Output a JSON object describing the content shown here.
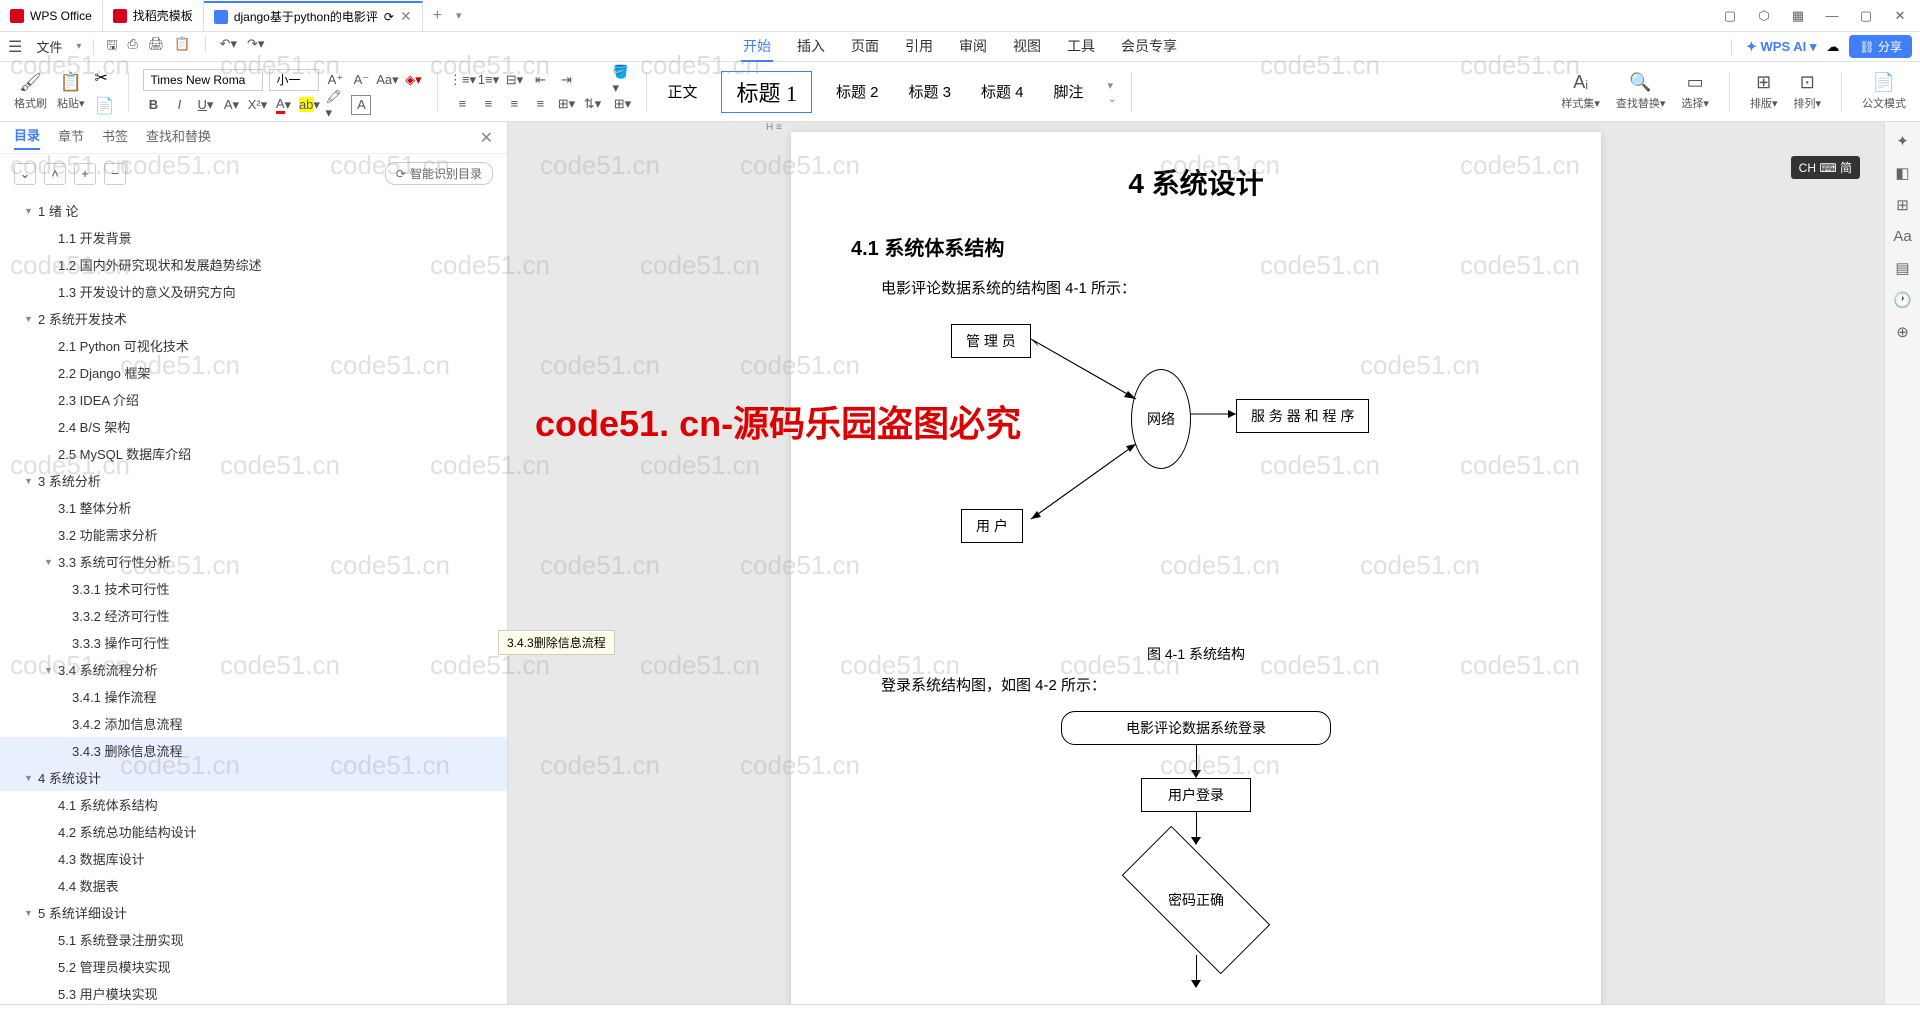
{
  "titlebar": {
    "tabs": [
      {
        "label": "WPS Office",
        "icon": "wps"
      },
      {
        "label": "找稻壳模板",
        "icon": "docer"
      },
      {
        "label": "django基于python的电影评",
        "icon": "doc",
        "active": true
      }
    ],
    "win_icons": [
      "▢",
      "⬡",
      "▦",
      "—",
      "▢",
      "✕"
    ]
  },
  "menubar": {
    "file": "文件",
    "tabs": [
      "开始",
      "插入",
      "页面",
      "引用",
      "审阅",
      "视图",
      "工具",
      "会员专享"
    ],
    "active_tab": "开始",
    "wps_ai": "WPS AI",
    "share": "分享"
  },
  "ribbon": {
    "format_painter": "格式刷",
    "paste": "粘贴",
    "font": "Times New Roma",
    "size": "小一",
    "styles": {
      "normal": "正文",
      "h1": "标题 1",
      "h2": "标题 2",
      "h3": "标题 3",
      "h4": "标题 4"
    },
    "footnote": "脚注",
    "styleset": "样式集",
    "findreplace": "查找替换",
    "select": "选择",
    "sort": "排版",
    "arrange": "排列",
    "official": "公文模式"
  },
  "sidebar": {
    "tabs": [
      "目录",
      "章节",
      "书签",
      "查找和替换"
    ],
    "active": "目录",
    "auto_toc": "智能识别目录",
    "toc": [
      {
        "level": 1,
        "num": "1",
        "title": "绪 论",
        "arrow": true
      },
      {
        "level": 2,
        "num": "1.1",
        "title": "开发背景"
      },
      {
        "level": 2,
        "num": "1.2",
        "title": "国内外研究现状和发展趋势综述"
      },
      {
        "level": 2,
        "num": "1.3",
        "title": "开发设计的意义及研究方向"
      },
      {
        "level": 1,
        "num": "2",
        "title": "系统开发技术",
        "arrow": true
      },
      {
        "level": 2,
        "num": "2.1",
        "title": "Python 可视化技术"
      },
      {
        "level": 2,
        "num": "2.2",
        "title": "Django 框架"
      },
      {
        "level": 2,
        "num": "2.3",
        "title": "IDEA 介绍"
      },
      {
        "level": 2,
        "num": "2.4",
        "title": "B/S 架构"
      },
      {
        "level": 2,
        "num": "2.5",
        "title": "MySQL 数据库介绍"
      },
      {
        "level": 1,
        "num": "3",
        "title": "系统分析",
        "arrow": true
      },
      {
        "level": 2,
        "num": "3.1",
        "title": "整体分析"
      },
      {
        "level": 2,
        "num": "3.2",
        "title": "功能需求分析"
      },
      {
        "level": 2,
        "num": "3.3",
        "title": "系统可行性分析",
        "arrow": true
      },
      {
        "level": 3,
        "num": "3.3.1",
        "title": "技术可行性"
      },
      {
        "level": 3,
        "num": "3.3.2",
        "title": "经济可行性"
      },
      {
        "level": 3,
        "num": "3.3.3",
        "title": "操作可行性"
      },
      {
        "level": 2,
        "num": "3.4",
        "title": "系统流程分析",
        "arrow": true
      },
      {
        "level": 3,
        "num": "3.4.1",
        "title": "操作流程"
      },
      {
        "level": 3,
        "num": "3.4.2",
        "title": "添加信息流程"
      },
      {
        "level": 3,
        "num": "3.4.3",
        "title": "删除信息流程",
        "selected": true
      },
      {
        "level": 1,
        "num": "4",
        "title": "系统设计",
        "arrow": true,
        "selected": true
      },
      {
        "level": 2,
        "num": "4.1",
        "title": "系统体系结构"
      },
      {
        "level": 2,
        "num": "4.2",
        "title": "系统总功能结构设计"
      },
      {
        "level": 2,
        "num": "4.3",
        "title": "数据库设计"
      },
      {
        "level": 2,
        "num": "4.4",
        "title": "数据表"
      },
      {
        "level": 1,
        "num": "5",
        "title": "系统详细设计",
        "arrow": true
      },
      {
        "level": 2,
        "num": "5.1",
        "title": "系统登录注册实现"
      },
      {
        "level": 2,
        "num": "5.2",
        "title": "管理员模块实现"
      },
      {
        "level": 2,
        "num": "5.3",
        "title": "用户模块实现"
      }
    ],
    "tooltip": "3.4.3删除信息流程"
  },
  "document": {
    "h1": "4 系统设计",
    "h2": "4.1  系统体系结构",
    "p1": "电影评论数据系统的结构图 4-1 所示：",
    "box_admin": "管 理 员",
    "box_network": "网络",
    "box_server": "服 务 器 和 程 序",
    "box_user": "用    户",
    "caption1": "图 4-1 系统结构",
    "p2": "登录系统结构图，如图 4-2 所示：",
    "flow_login_sys": "电影评论数据系统登录",
    "flow_user_login": "用户登录",
    "flow_pwd": "密码正确"
  },
  "ime": "CH ⌨ 简",
  "watermark_text": "code51.cn",
  "watermark_red": "code51. cn-源码乐园盗图必究"
}
